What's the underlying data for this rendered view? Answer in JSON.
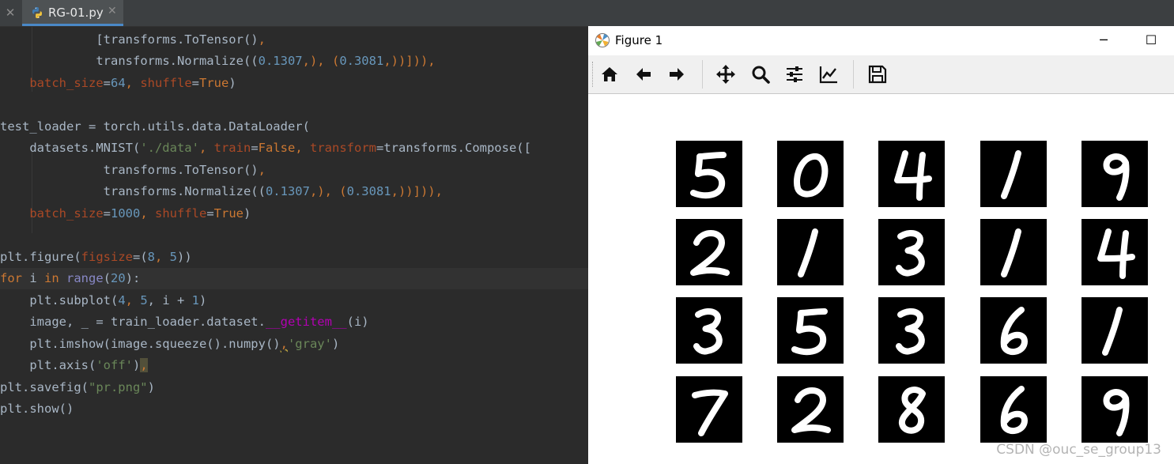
{
  "tabbar": {
    "close_glyph": "✕",
    "tab_label": "RG-01.py",
    "tab_close_glyph": "✕"
  },
  "editor": {
    "lines": [
      [
        "             ",
        "[transforms.ToTensor()"
      ],
      [
        "              ",
        "transforms.Normalize(("
      ],
      [
        "    ",
        "batch_size"
      ],
      [
        ""
      ],
      [
        "test_loader = torch.utils.data.DataLoader("
      ],
      [
        "    datasets.MNIST("
      ],
      [
        "             ",
        "transforms.ToTensor()"
      ],
      [
        "             ",
        "transforms.Normalize(("
      ],
      [
        "    ",
        "batch_size"
      ],
      [
        ""
      ],
      [
        "plt.figure("
      ],
      [
        "for"
      ],
      [
        "    plt.subplot("
      ],
      [
        "    image, _ = train_loader.dataset."
      ],
      [
        "    plt.imshow(image.squeeze().numpy()"
      ],
      [
        "    plt.axis("
      ],
      [
        "plt.savefig("
      ],
      [
        "plt.show()"
      ]
    ],
    "tokens": {
      "l1_a": "[transforms.ToTensor()",
      "l1_b": ",",
      "l2_a": "transforms.Normalize((",
      "l2_n1": "0.1307",
      "l2_b": ",), (",
      "l2_n2": "0.3081",
      "l2_c": ",))])),",
      "l3_p1": "batch_size",
      "l3_eq": "=",
      "l3_n": "64",
      "l3_c": ", ",
      "l3_p2": "shuffle",
      "l3_eq2": "=",
      "l3_kw": "True",
      "l3_end": ")",
      "l5": "test_loader = torch.utils.data.DataLoader(",
      "l6_a": "datasets.MNIST(",
      "l6_s": "'./data'",
      "l6_c1": ", ",
      "l6_p1": "train",
      "l6_eq1": "=",
      "l6_kw": "False",
      "l6_c2": ", ",
      "l6_p2": "transform",
      "l6_eq2": "=transforms.Compose([",
      "l7_a": "transforms.ToTensor()",
      "l7_b": ",",
      "l8_a": "transforms.Normalize((",
      "l8_n1": "0.1307",
      "l8_b": ",), (",
      "l8_n2": "0.3081",
      "l8_c": ",))])),",
      "l9_p1": "batch_size",
      "l9_eq": "=",
      "l9_n": "1000",
      "l9_c": ", ",
      "l9_p2": "shuffle",
      "l9_eq2": "=",
      "l9_kw": "True",
      "l9_end": ")",
      "l11_a": "plt.figure(",
      "l11_p": "figsize",
      "l11_eq": "=(",
      "l11_n1": "8",
      "l11_c": ", ",
      "l11_n2": "5",
      "l11_end": "))",
      "l12_kw1": "for",
      "l12_a": " i ",
      "l12_kw2": "in",
      "l12_sp": " ",
      "l12_bi": "range",
      "l12_b": "(",
      "l12_n": "20",
      "l12_end": "):",
      "l13_a": "plt.subplot(",
      "l13_n1": "4",
      "l13_c1": ", ",
      "l13_n2": "5",
      "l13_c2": ", i + ",
      "l13_n3": "1",
      "l13_end": ")",
      "l14_a": "image, _ = train_loader.dataset.",
      "l14_m": "__getitem__",
      "l14_end": "(i)",
      "l15_a": "plt.imshow(image.squeeze().numpy()",
      "l15_c": ",",
      "l15_s": "'gray'",
      "l15_end": ")",
      "l16_a": "plt.axis(",
      "l16_s": "'off'",
      "l16_b": ")",
      "l16_w": ",",
      "l17_a": "plt.savefig(",
      "l17_s": "\"pr.png\"",
      "l17_end": ")",
      "l18": "plt.show()"
    }
  },
  "figure": {
    "title": "Figure 1",
    "minimize_glyph": "─",
    "maximize_glyph": "☐",
    "toolbar": [
      "home-icon",
      "back-icon",
      "forward-icon",
      "pan-icon",
      "zoom-icon",
      "configure-subplots-icon",
      "edit-axes-icon",
      "save-icon"
    ],
    "digits": [
      [
        "5",
        "0",
        "4",
        "1",
        "9"
      ],
      [
        "2",
        "1",
        "3",
        "1",
        "4"
      ],
      [
        "3",
        "5",
        "3",
        "6",
        "1"
      ],
      [
        "7",
        "2",
        "8",
        "6",
        "9"
      ]
    ]
  },
  "watermark": "CSDN @ouc_se_group13",
  "colors": {
    "editor_bg": "#2b2b2b",
    "keyword": "#cc7832",
    "param": "#aa4926",
    "number": "#6897bb",
    "string": "#6a8759",
    "magic": "#b200b2"
  }
}
